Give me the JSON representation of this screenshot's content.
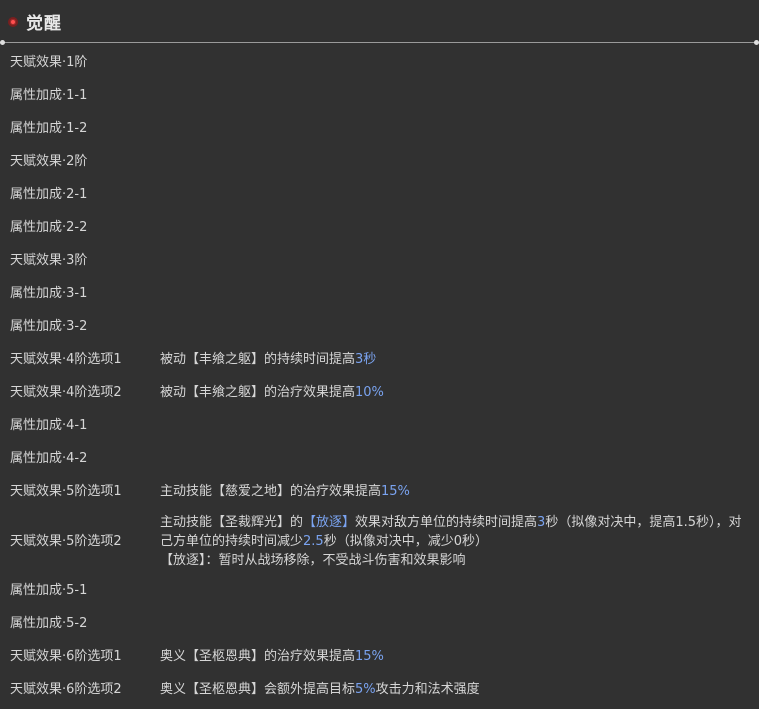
{
  "section": {
    "title": "觉醒"
  },
  "colors": {
    "highlight": "#7aa3f0",
    "text": "#d6d6d6",
    "background": "#313131",
    "marker": "#ff4f4f"
  },
  "rows": [
    {
      "name": "天赋效果·1阶",
      "effect": []
    },
    {
      "name": "属性加成·1-1",
      "effect": []
    },
    {
      "name": "属性加成·1-2",
      "effect": []
    },
    {
      "name": "天赋效果·2阶",
      "effect": []
    },
    {
      "name": "属性加成·2-1",
      "effect": []
    },
    {
      "name": "属性加成·2-2",
      "effect": []
    },
    {
      "name": "天赋效果·3阶",
      "effect": []
    },
    {
      "name": "属性加成·3-1",
      "effect": []
    },
    {
      "name": "属性加成·3-2",
      "effect": []
    },
    {
      "name": "天赋效果·4阶选项1",
      "effect": [
        [
          {
            "t": "被动【丰飨之躯】的持续时间提高"
          },
          {
            "t": "3秒",
            "h": true
          }
        ]
      ]
    },
    {
      "name": "天赋效果·4阶选项2",
      "effect": [
        [
          {
            "t": "被动【丰飨之躯】的治疗效果提高"
          },
          {
            "t": "10%",
            "h": true
          }
        ]
      ]
    },
    {
      "name": "属性加成·4-1",
      "effect": []
    },
    {
      "name": "属性加成·4-2",
      "effect": []
    },
    {
      "name": "天赋效果·5阶选项1",
      "effect": [
        [
          {
            "t": "主动技能【慈爱之地】的治疗效果提高"
          },
          {
            "t": "15%",
            "h": true
          }
        ]
      ]
    },
    {
      "name": "天赋效果·5阶选项2",
      "tall": true,
      "effect": [
        [
          {
            "t": "主动技能【圣裁辉光】的"
          },
          {
            "t": "【放逐】",
            "h": true
          },
          {
            "t": "效果对敌方单位的持续时间提高"
          },
          {
            "t": "3",
            "h": true
          },
          {
            "t": "秒（拟像对决中，提高1.5秒），对己方单位的持续时间减少"
          },
          {
            "t": "2.5",
            "h": true
          },
          {
            "t": "秒（拟像对决中，减少0秒）"
          }
        ],
        [
          {
            "t": "【放逐】：暂时从战场移除，不受战斗伤害和效果影响"
          }
        ]
      ]
    },
    {
      "name": "属性加成·5-1",
      "effect": []
    },
    {
      "name": "属性加成·5-2",
      "effect": []
    },
    {
      "name": "天赋效果·6阶选项1",
      "effect": [
        [
          {
            "t": "奥义【圣柩恩典】的治疗效果提高"
          },
          {
            "t": "15%",
            "h": true
          }
        ]
      ]
    },
    {
      "name": "天赋效果·6阶选项2",
      "effect": [
        [
          {
            "t": "奥义【圣柩恩典】会额外提高目标"
          },
          {
            "t": "5%",
            "h": true
          },
          {
            "t": "攻击力和法术强度"
          }
        ]
      ]
    }
  ]
}
